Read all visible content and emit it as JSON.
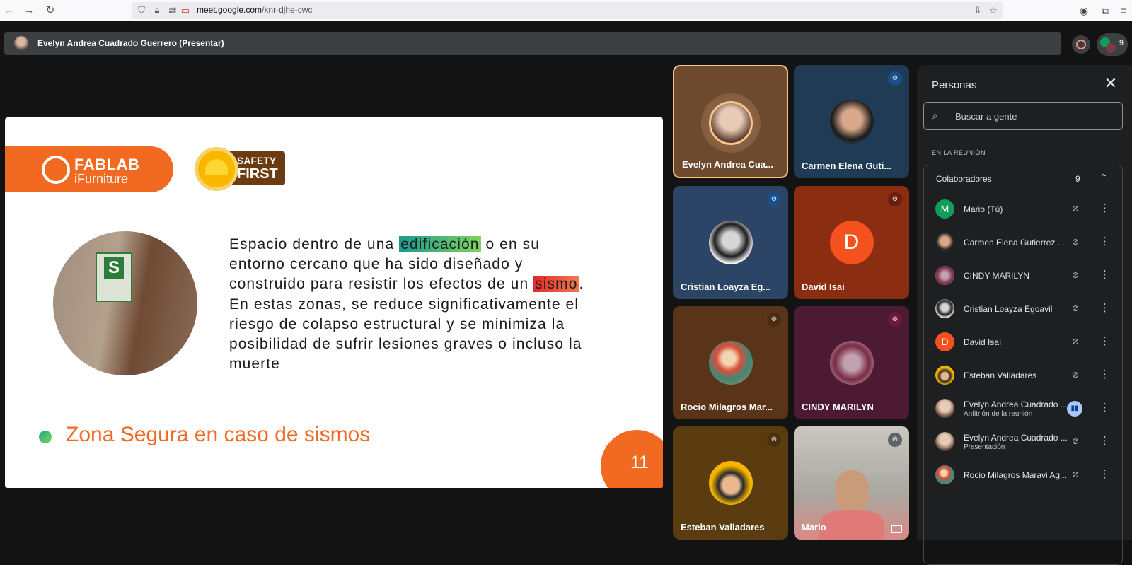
{
  "browser": {
    "url_host": "meet.google.com",
    "url_path": "/xnr-djhe-cwc"
  },
  "presenter_bar": {
    "title": "Evelyn Andrea Cuadrado Guerrero (Presentar)",
    "participant_count": "9"
  },
  "slide": {
    "brand_line1": "FABLAB",
    "brand_line2": "iFurniture",
    "safety_line1": "SAFETY",
    "safety_line2": "FIRST",
    "sign_letter": "S",
    "text_part1": "Espacio dentro de una ",
    "text_highlight1": "edificación",
    "text_part2": " o en su entorno cercano que ha sido diseñado y construido para resistir los efectos de un ",
    "text_highlight2": "sismo",
    "text_part3": ". En estas zonas, se reduce significativamente el riesgo de colapso estructural y se minimiza la posibilidad de sufrir lesiones graves o incluso la muerte",
    "footer_title": "Zona Segura en caso de sismos",
    "page_number": "11"
  },
  "tiles": [
    {
      "name": "Evelyn Andrea Cua...",
      "bg": "#6d4a2e"
    },
    {
      "name": "Carmen Elena Guti...",
      "bg": "#1f3b55"
    },
    {
      "name": "Cristian Loayza Eg...",
      "bg": "#2c4466"
    },
    {
      "name": "David Isai",
      "bg": "#8a2d10",
      "letter": "D"
    },
    {
      "name": "Rocio Milagros Mar...",
      "bg": "#5a3418"
    },
    {
      "name": "CINDY MARILYN",
      "bg": "#4d1a33"
    },
    {
      "name": "Esteban Valladares",
      "bg": "#5a3c10"
    },
    {
      "name": "Mario",
      "bg": "#a9a7a0"
    }
  ],
  "panel": {
    "title": "Personas",
    "search_placeholder": "Buscar a gente",
    "section_label": "EN LA REUNIÓN",
    "group_title": "Colaboradores",
    "group_count": "9",
    "people": [
      {
        "name": "Mario (Tú)",
        "avatar_letter": "M",
        "avatar_color": "#0f9d58"
      },
      {
        "name": "Carmen Elena Gutierrez ...",
        "avatar_color": "#1f5a7a"
      },
      {
        "name": "CINDY MARILYN",
        "avatar_color": "#7a3a4a"
      },
      {
        "name": "Cristian Loayza Egoavil",
        "avatar_color": "#d8d8d8"
      },
      {
        "name": "David Isaí",
        "avatar_letter": "D",
        "avatar_color": "#f4511e"
      },
      {
        "name": "Esteban Valladares",
        "avatar_color": "#f4b400"
      },
      {
        "name": "Evelyn Andrea Cuadrado ...",
        "subtitle": "Anfitrión de la reunión",
        "avatar_color": "#b08a78"
      },
      {
        "name": "Evelyn Andrea Cuadrado ...",
        "subtitle": "Presentación",
        "avatar_color": "#b08a78"
      },
      {
        "name": "Rocio Milagros Maravi Ag...",
        "avatar_color": "#e0784a"
      }
    ]
  }
}
